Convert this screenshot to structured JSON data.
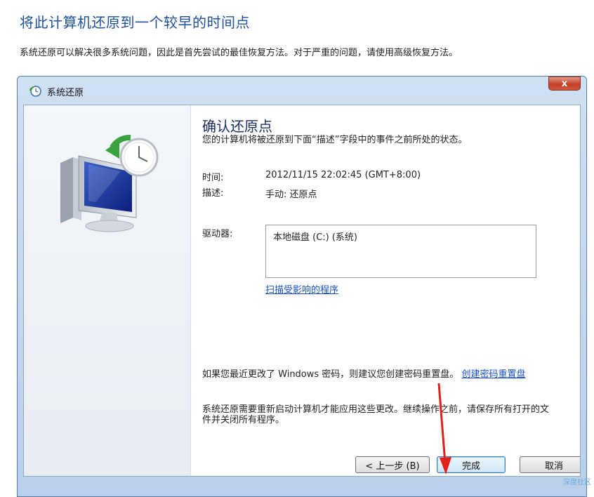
{
  "page": {
    "heading": "将此计算机还原到一个较早的时间点",
    "intro": "系统还原可以解决很多系统问题，因此是首先尝试的最佳恢复方法。对于严重的问题，请使用高级恢复方法。"
  },
  "dialog": {
    "title": "系统还原",
    "close_label": "x",
    "confirm_title": "确认还原点",
    "confirm_desc": "您的计算机将被还原到下面“描述”字段中的事件之前所处的状态。",
    "time_label": "时间:",
    "time_value": "2012/11/15 22:02:45 (GMT+8:00)",
    "desc_label": "描述:",
    "desc_value": "手动: 还原点",
    "drive_label": "驱动器:",
    "drive_value": "本地磁盘 (C:) (系统)",
    "scan_link": "扫描受影响的程序",
    "password_note": "如果您最近更改了 Windows 密码，则建议您创建密码重置盘。",
    "password_link": "创建密码重置盘",
    "restart_note": "系统还原需要重新启动计算机才能应用这些更改。继续操作之前，请保存所有打开的文件并关闭所有程序。",
    "buttons": {
      "back": "< 上一步 (B)",
      "finish": "完成",
      "cancel": "取消"
    }
  },
  "watermark": "深度社区",
  "colors": {
    "heading": "#1e4f9c",
    "link": "#1a4fc4",
    "annotation_arrow": "#e0201c"
  },
  "icons": {
    "title": "system-restore-icon",
    "illustration": "monitor-clock-restore-icon"
  }
}
